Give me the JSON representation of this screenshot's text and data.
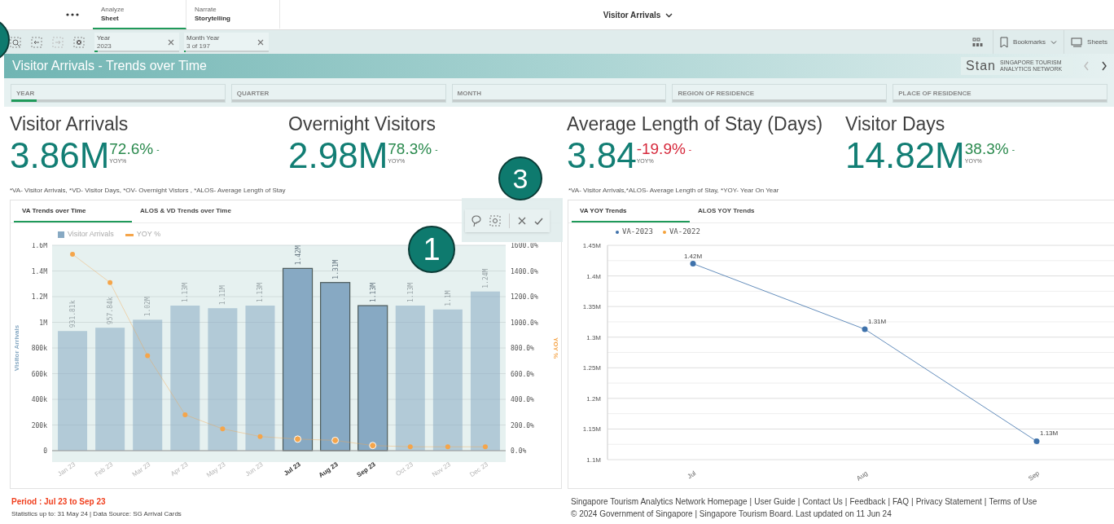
{
  "top_nav": {
    "tabs": [
      {
        "overline": "Analyze",
        "label": "Sheet",
        "selected": true
      },
      {
        "overline": "Narrate",
        "label": "Storytelling",
        "selected": false
      }
    ],
    "sheet_title": "Visitor Arrivals"
  },
  "toolbar": {
    "selections": [
      {
        "field": "Year",
        "value": "2023",
        "level": 0.04
      },
      {
        "field": "Month Year",
        "value": "3 of 197",
        "level": 0.02
      }
    ],
    "bookmarks_label": "Bookmarks",
    "sheets_label": "Sheets"
  },
  "banner": {
    "title": "Visitor Arrivals - Trends over Time",
    "logo_mark": "Stan",
    "logo_tagline": "SINGAPORE TOURISM ANALYTICS NETWORK"
  },
  "filters": [
    {
      "label": "YEAR",
      "selected": true
    },
    {
      "label": "QUARTER",
      "selected": false
    },
    {
      "label": "MONTH",
      "selected": false
    },
    {
      "label": "REGION OF RESIDENCE",
      "selected": false
    },
    {
      "label": "PLACE OF RESIDENCE",
      "selected": false
    }
  ],
  "kpis": [
    {
      "title": "Visitor Arrivals",
      "value": "3.86M",
      "change": "72.6%",
      "color": "#2b8a4e",
      "indicator": "-",
      "caption": "YOY%"
    },
    {
      "title": "Overnight Visitors",
      "value": "2.98M",
      "change": "78.3%",
      "color": "#2b8a4e",
      "indicator": "-",
      "caption": "YOY%"
    },
    {
      "title": "Average Length of Stay (Days)",
      "value": "3.84",
      "change": "-19.9%",
      "color": "#d6283b",
      "indicator": "-",
      "caption": "YOY%"
    },
    {
      "title": "Visitor Days",
      "value": "14.82M",
      "change": "38.3%",
      "color": "#2b8a4e",
      "indicator": "-",
      "caption": "YOY%"
    }
  ],
  "notes": [
    "*VA- Visitor Arrivals, *VD- Visitor Days, *OV- Overnight Vistors , *ALOS- Average Length of Stay",
    "*VA- Visitor Arrivals,*ALOS- Average Length of Stay, *YOY- Year On Year"
  ],
  "va_panel": {
    "tabs": [
      {
        "label": "VA Trends over Time",
        "selected": true
      },
      {
        "label": "ALOS & VD Trends over Time",
        "selected": false
      }
    ],
    "bars": [
      {
        "selected": false
      },
      {
        "selected": false
      },
      {
        "selected": false
      },
      {
        "selected": false
      },
      {
        "selected": false
      },
      {
        "selected": false
      },
      {
        "selected": true
      },
      {
        "selected": true
      },
      {
        "selected": true
      },
      {
        "selected": false
      },
      {
        "selected": false
      },
      {
        "selected": false
      }
    ],
    "chart_data": {
      "type": "bar",
      "ylabel": "Visitor Arrivals",
      "y2label": "YOY %",
      "grid": true,
      "y2lim": [
        0,
        1600
      ],
      "categories": [
        "Jan 23",
        "Feb 23",
        "Mar 23",
        "Apr 23",
        "May 23",
        "Jun 23",
        "Jul 23",
        "Aug 23",
        "Sep 23",
        "Oct 23",
        "Nov 23",
        "Dec 23"
      ],
      "ylim": [
        0,
        1600000
      ],
      "yticks": [
        {
          "value": 0,
          "label": "0"
        },
        {
          "value": 200000,
          "label": "200k"
        },
        {
          "value": 400000,
          "label": "400k"
        },
        {
          "value": 600000,
          "label": "600k"
        },
        {
          "value": 800000,
          "label": "800k"
        },
        {
          "value": 1000000,
          "label": "1M"
        },
        {
          "value": 1200000,
          "label": "1.2M"
        },
        {
          "value": 1400000,
          "label": "1.4M"
        },
        {
          "value": 1600000,
          "label": "1.6M"
        }
      ],
      "y2ticks": [
        {
          "value": 0,
          "label": "0.0%"
        },
        {
          "value": 200,
          "label": "200.0%"
        },
        {
          "value": 400,
          "label": "400.0%"
        },
        {
          "value": 600,
          "label": "600.0%"
        },
        {
          "value": 800,
          "label": "800.0%"
        },
        {
          "value": 1000,
          "label": "1000.0%"
        },
        {
          "value": 1200,
          "label": "1200.0%"
        },
        {
          "value": 1400,
          "label": "1400.0%"
        },
        {
          "value": 1600,
          "label": "1600.0%"
        }
      ],
      "series": [
        {
          "name": "Visitor Arrivals",
          "color": "#87a9c3",
          "values": [
            931810,
            957840,
            1020000,
            1130000,
            1110000,
            1130000,
            1420000,
            1310000,
            1130000,
            1130000,
            1100000,
            1240000
          ],
          "value_labels": [
            "931.81k",
            "957.84k",
            "1.02M",
            "1.13M",
            "1.11M",
            "1.13M",
            "1.42M",
            "1.31M",
            "1.13M",
            "1.13M",
            "1.1M",
            "1.24M"
          ]
        },
        {
          "name": "YOY %",
          "type": "line",
          "axis": "y2",
          "marker": "circle",
          "color": "#f5a54a",
          "values": [
            1530,
            1310,
            740,
            280,
            170,
            110,
            90,
            80,
            40,
            30,
            30,
            30
          ]
        }
      ]
    }
  },
  "yoy_panel": {
    "tabs": [
      {
        "label": "VA YOY Trends",
        "selected": true
      },
      {
        "label": "ALOS YOY Trends",
        "selected": false
      }
    ],
    "chart_data": {
      "type": "line",
      "x": [
        "Jul",
        "Aug",
        "Sep"
      ],
      "ylim": [
        1100000,
        1450000
      ],
      "grid": true,
      "yticks": [
        {
          "value": 1100000,
          "label": "1.1M"
        },
        {
          "value": 1150000,
          "label": "1.15M"
        },
        {
          "value": 1200000,
          "label": "1.2M"
        },
        {
          "value": 1250000,
          "label": "1.25M"
        },
        {
          "value": 1300000,
          "label": "1.3M"
        },
        {
          "value": 1350000,
          "label": "1.35M"
        },
        {
          "value": 1400000,
          "label": "1.4M"
        },
        {
          "value": 1450000,
          "label": "1.45M"
        }
      ],
      "series": [
        {
          "name": "VA-2023",
          "color": "#3f72ab",
          "marker": "circle",
          "values": [
            1420000,
            1313000,
            1130000
          ],
          "value_labels": [
            "1.42M",
            "1.31M",
            "1.13M"
          ]
        },
        {
          "name": "VA-2022",
          "color": "#f5a23a",
          "values": [
            null,
            null,
            null
          ]
        }
      ]
    }
  },
  "footer_left": {
    "period": "Period : Jul 23 to Sep 23",
    "source": "Statistics up to: 31 May 24 | Data Source: SG Arrival Cards"
  },
  "footer_right": {
    "separator": "|",
    "links": [
      "Singapore Tourism Analytics Network Homepage",
      "User Guide",
      "Contact Us",
      "Feedback",
      "FAQ",
      "Privacy Statement",
      "Terms of Use"
    ],
    "copyright": "© 2024 Government of Singapore | Singapore Tourism Board. Last updated on 11 Jun 24"
  },
  "callouts": [
    {
      "label": "3"
    },
    {
      "label": "1"
    }
  ],
  "edge_callout": true
}
